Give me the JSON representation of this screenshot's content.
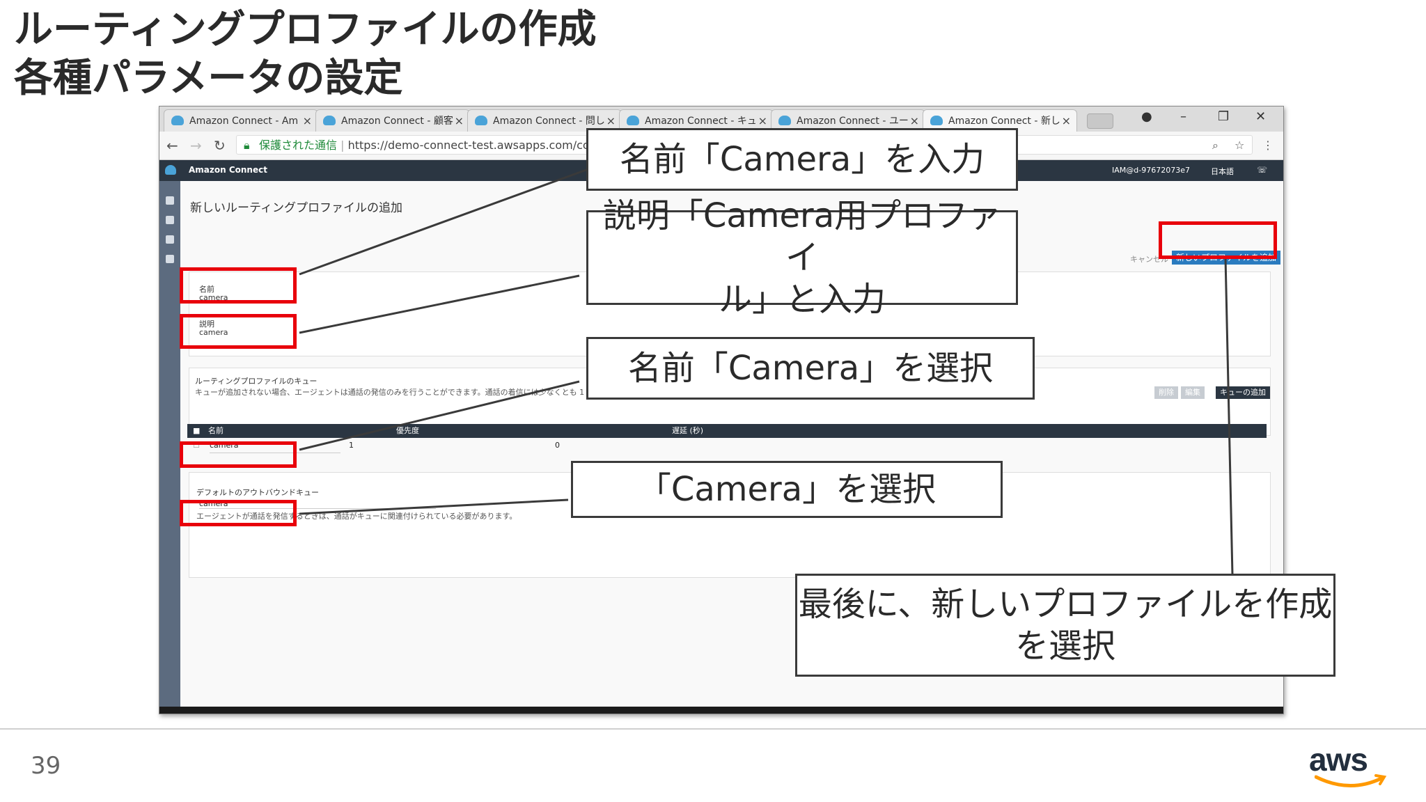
{
  "slide": {
    "title_line1": "ルーティングプロファイルの作成",
    "title_line2": "各種パラメータの設定",
    "page_number": "39",
    "logo_text": "aws"
  },
  "browser": {
    "tabs": [
      {
        "label": "Amazon Connect - Am"
      },
      {
        "label": "Amazon Connect - 顧客"
      },
      {
        "label": "Amazon Connect - 問し"
      },
      {
        "label": "Amazon Connect - キュ"
      },
      {
        "label": "Amazon Connect - ユー"
      },
      {
        "label": "Amazon Connect - 新し"
      }
    ],
    "secure_label": "保護された通信",
    "url": "https://demo-connect-test.awsapps.com/connect"
  },
  "app": {
    "brand": "Amazon Connect",
    "user": "IAM@d-97672073e7",
    "language": "日本語",
    "page_heading": "新しいルーティングプロファイルの追加",
    "cancel_label": "キャンセル",
    "create_label": "新しいプロファイルを追加",
    "name_label": "名前",
    "name_value": "camera",
    "desc_label": "説明",
    "desc_value": "camera",
    "queues_title": "ルーティングプロファイルのキュー",
    "queues_note": "キューが追加されない場合、エージェントは通話の発信のみを行うことができます。通話の着信には少なくとも 1 つのキューが必要であり、重複していない必要があります。",
    "delete_label": "削除",
    "edit_label": "編集",
    "add_queue_label": "キューの追加",
    "table_headers": [
      "名前",
      "優先度",
      "遅延 (秒)"
    ],
    "table_row": {
      "name": "camera",
      "priority": "1",
      "delay": "0"
    },
    "outbound_title": "デフォルトのアウトバウンドキュー",
    "outbound_value": "camera",
    "outbound_note": "エージェントが通話を発信するときは、通話がキューに関連付けられている必要があります。"
  },
  "callouts": {
    "name_input": "名前「Camera」を入力",
    "desc_input_line1": "説明「Camera用プロファイ",
    "desc_input_line2": "ル」と入力",
    "name_select": "名前「Camera」を選択",
    "camera_select": "「Camera」を選択",
    "final_line1": "最後に、新しいプロファイルを作成",
    "final_line2": "を選択"
  },
  "colors": {
    "highlight_red": "#e8000b",
    "appbar": "#2b3642",
    "sidebar": "#5c6b7f",
    "primary_button": "#2a7bbf"
  }
}
